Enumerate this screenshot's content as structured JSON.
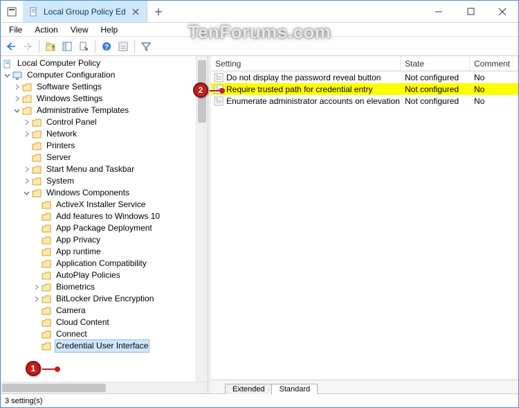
{
  "window": {
    "tab_title": "Local Group Policy Ed",
    "watermark": "TenForums.com"
  },
  "menu": {
    "file": "File",
    "action": "Action",
    "view": "View",
    "help": "Help"
  },
  "tree": {
    "root": "Local Computer Policy",
    "comp_config": "Computer Configuration",
    "software": "Software Settings",
    "windows_settings": "Windows Settings",
    "admin_templates": "Administrative Templates",
    "control_panel": "Control Panel",
    "network": "Network",
    "printers": "Printers",
    "server": "Server",
    "start_menu": "Start Menu and Taskbar",
    "system": "System",
    "win_components": "Windows Components",
    "activex": "ActiveX Installer Service",
    "add_features": "Add features to Windows 10",
    "app_pkg": "App Package Deployment",
    "app_privacy": "App Privacy",
    "app_runtime": "App runtime",
    "app_compat": "Application Compatibility",
    "autoplay": "AutoPlay Policies",
    "biometrics": "Biometrics",
    "bitlocker": "BitLocker Drive Encryption",
    "camera": "Camera",
    "cloud": "Cloud Content",
    "connect": "Connect",
    "cred_ui": "Credential User Interface"
  },
  "grid": {
    "headers": {
      "setting": "Setting",
      "state": "State",
      "comment": "Comment"
    },
    "rows": [
      {
        "setting": "Do not display the password reveal button",
        "state": "Not configured",
        "comment": "No",
        "selected": false
      },
      {
        "setting": "Require trusted path for credential entry",
        "state": "Not configured",
        "comment": "No",
        "selected": true
      },
      {
        "setting": "Enumerate administrator accounts on elevation",
        "state": "Not configured",
        "comment": "No",
        "selected": false
      }
    ],
    "tabs": {
      "extended": "Extended",
      "standard": "Standard"
    }
  },
  "status": {
    "text": "3 setting(s)"
  },
  "annotations": {
    "a1": "1",
    "a2": "2"
  }
}
